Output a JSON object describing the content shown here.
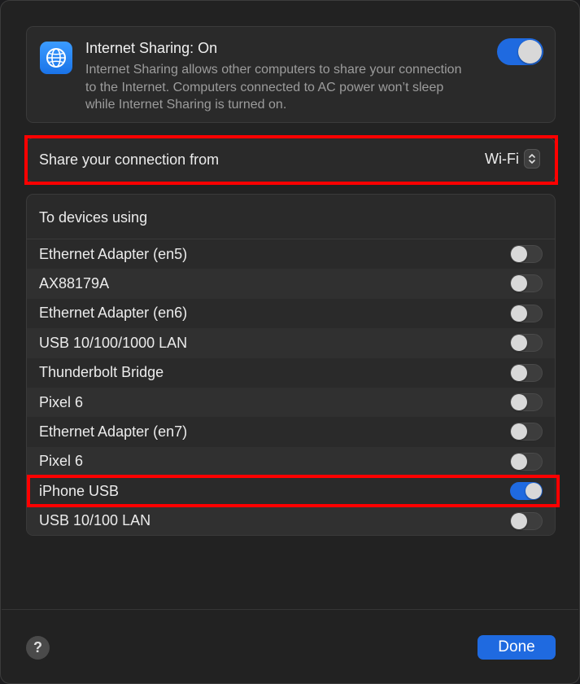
{
  "header": {
    "icon": "globe-icon",
    "title": "Internet Sharing: On",
    "description": "Internet Sharing allows other computers to share your connection to the Internet. Computers connected to AC power won’t sleep while Internet Sharing is turned on.",
    "toggle_on": true
  },
  "share_from": {
    "label": "Share your connection from",
    "value": "Wi-Fi"
  },
  "devices": {
    "title": "To devices using",
    "items": [
      {
        "label": "Ethernet Adapter (en5)",
        "on": false
      },
      {
        "label": "AX88179A",
        "on": false
      },
      {
        "label": "Ethernet Adapter (en6)",
        "on": false
      },
      {
        "label": "USB 10/100/1000 LAN",
        "on": false
      },
      {
        "label": "Thunderbolt Bridge",
        "on": false
      },
      {
        "label": "Pixel 6",
        "on": false
      },
      {
        "label": "Ethernet Adapter (en7)",
        "on": false
      },
      {
        "label": "Pixel 6",
        "on": false
      },
      {
        "label": "iPhone USB",
        "on": true
      },
      {
        "label": "USB 10/100 LAN",
        "on": false
      }
    ]
  },
  "footer": {
    "help_label": "?",
    "done_label": "Done"
  },
  "colors": {
    "accent": "#1f6ae0",
    "highlight": "#ff0000"
  }
}
